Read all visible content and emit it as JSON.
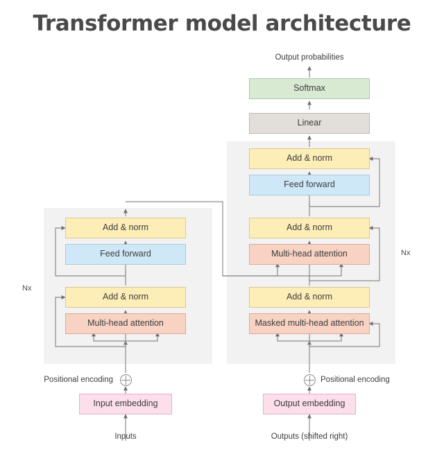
{
  "title": "Transformer model architecture",
  "colors": {
    "background": "#ffffff",
    "panel": "#f2f2f2",
    "title_text": "#4a4a4a",
    "node_text": "#3c3c3c",
    "wire": "#8a8a8a",
    "softmax": "#d9ead3",
    "linear": "#e2ded9",
    "add_norm": "#fdeeb8",
    "feed_forward": "#cfe8f7",
    "attention": "#f8d2c3",
    "embedding": "#fcdfeb"
  },
  "captions": {
    "output_probabilities": "Output probabilities",
    "inputs": "Inputs",
    "outputs_shifted": "Outputs (shifted right)",
    "positional_encoding_left": "Positional encoding",
    "positional_encoding_right": "Positional encoding",
    "nx_left": "Nx",
    "nx_right": "Nx"
  },
  "encoder": {
    "blocks": [
      {
        "label": "Add & norm",
        "style": "yellow"
      },
      {
        "label": "Feed forward",
        "style": "blue"
      },
      {
        "label": "Add & norm",
        "style": "yellow"
      },
      {
        "label": "Multi-head attention",
        "style": "salmon"
      }
    ],
    "embedding": {
      "label": "Input embedding",
      "style": "pink"
    }
  },
  "decoder": {
    "blocks": [
      {
        "label": "Softmax",
        "style": "green"
      },
      {
        "label": "Linear",
        "style": "gray"
      },
      {
        "label": "Add & norm",
        "style": "yellow"
      },
      {
        "label": "Feed forward",
        "style": "blue"
      },
      {
        "label": "Add & norm",
        "style": "yellow"
      },
      {
        "label": "Multi-head attention",
        "style": "salmon"
      },
      {
        "label": "Add & norm",
        "style": "yellow"
      },
      {
        "label": "Masked multi-head attention",
        "style": "salmon"
      }
    ],
    "embedding": {
      "label": "Output embedding",
      "style": "pink"
    }
  }
}
